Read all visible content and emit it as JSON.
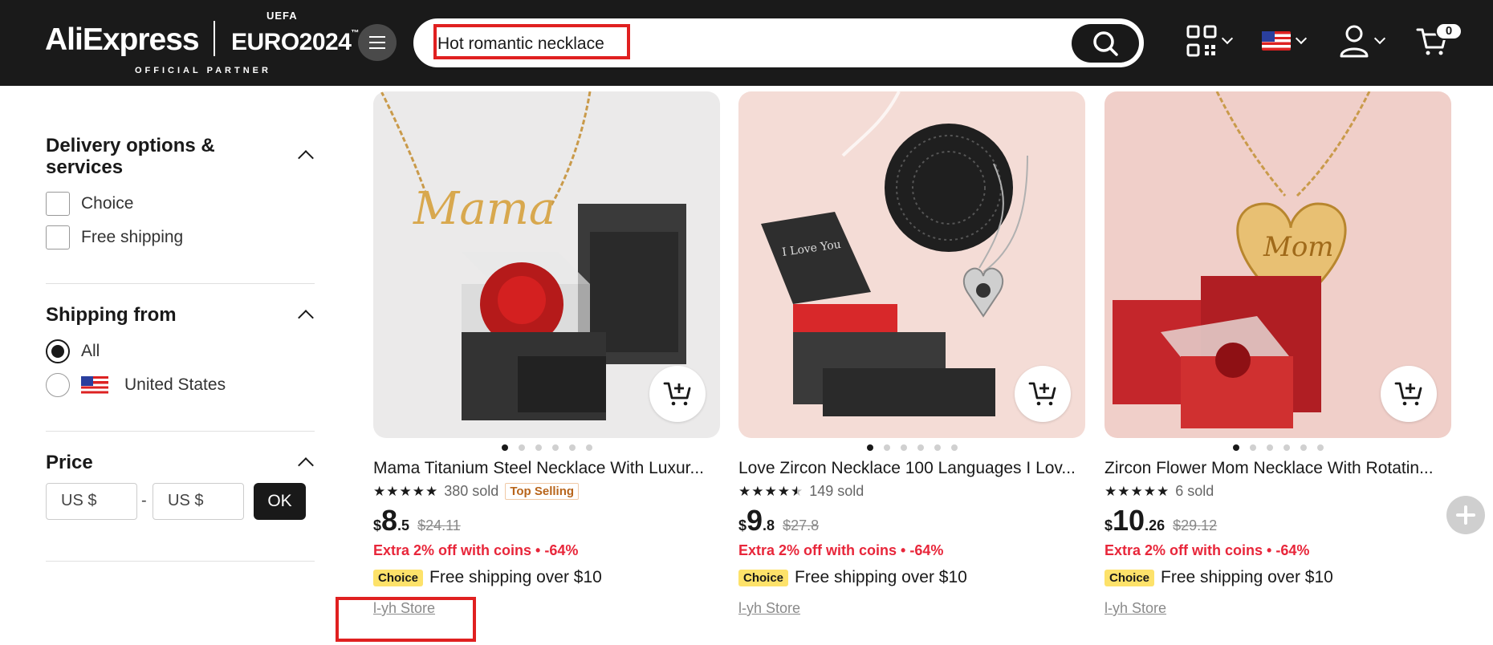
{
  "header": {
    "logo_text": "AliExpress",
    "euro_text": "EURO2024",
    "uefa_text": "UEFA",
    "partner_text": "OFFICIAL PARTNER",
    "search_value": "Hot romantic necklace",
    "cart_count": "0"
  },
  "sidebar": {
    "delivery": {
      "title": "Delivery options & services",
      "options": [
        "Choice",
        "Free shipping"
      ]
    },
    "shipping_from": {
      "title": "Shipping from",
      "options": [
        "All",
        "United States"
      ],
      "selected": "All"
    },
    "price": {
      "title": "Price",
      "min_placeholder": "US $",
      "max_placeholder": "US $",
      "dash": "-",
      "ok_label": "OK"
    }
  },
  "products": [
    {
      "title": "Mama Titanium Steel Necklace With Luxur...",
      "rating": 5,
      "sold": "380 sold",
      "badge": "Top Selling",
      "currency": "$",
      "price_int": "8",
      "price_dec": ".5",
      "old_price": "$24.11",
      "promo": "Extra 2% off with coins • -64%",
      "choice": "Choice",
      "shipping": "Free shipping over $10",
      "store": "l-yh Store"
    },
    {
      "title": "Love Zircon Necklace 100 Languages I Lov...",
      "rating": 4.5,
      "sold": "149 sold",
      "badge": "",
      "currency": "$",
      "price_int": "9",
      "price_dec": ".8",
      "old_price": "$27.8",
      "promo": "Extra 2% off with coins • -64%",
      "choice": "Choice",
      "shipping": "Free shipping over $10",
      "store": "l-yh Store"
    },
    {
      "title": "Zircon Flower Mom Necklace With Rotatin...",
      "rating": 5,
      "sold": "6 sold",
      "badge": "",
      "currency": "$",
      "price_int": "10",
      "price_dec": ".26",
      "old_price": "$29.12",
      "promo": "Extra 2% off with coins • -64%",
      "choice": "Choice",
      "shipping": "Free shipping over $10",
      "store": "l-yh Store"
    }
  ],
  "icons": {
    "search": "search-icon",
    "qr": "qr-code-icon",
    "account": "user-icon",
    "cart": "cart-icon",
    "add_to_cart": "add-to-cart-icon",
    "menu": "menu-icon"
  },
  "colors": {
    "header_bg": "#1a1a1a",
    "promo_red": "#e8263a",
    "choice_yellow": "#fde26a",
    "highlight_red": "#e02020"
  }
}
